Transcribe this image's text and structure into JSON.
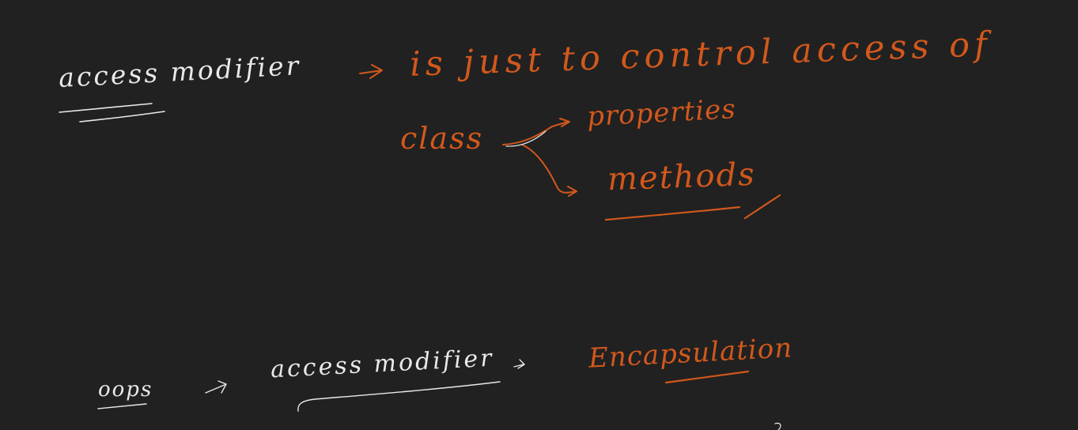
{
  "canvas": {
    "background_color": "#212121"
  },
  "colors": {
    "white_ink": "#e9e9e9",
    "orange_ink": "#d2581c"
  },
  "notes": {
    "access_modifier": "access modifier",
    "definition": "is just to control access of",
    "class_word": "class",
    "properties": "properties",
    "methods": "methods",
    "oops": "oops",
    "access_modifier_2": "access modifier",
    "encapsulation": "Encapsulation"
  }
}
